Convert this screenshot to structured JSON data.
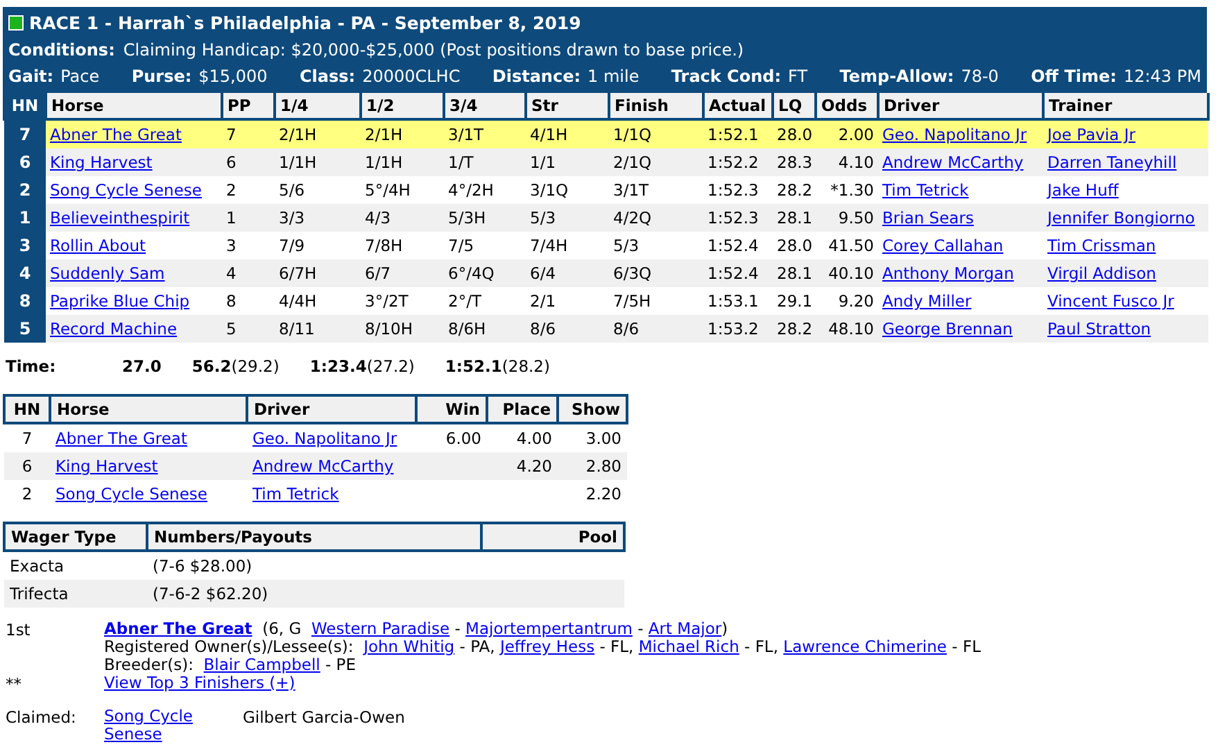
{
  "race": {
    "title": "RACE 1 - Harrah`s Philadelphia - PA - September 8, 2019",
    "conditions": {
      "label": "Conditions:",
      "value": "Claiming Handicap: $20,000-$25,000 (Post positions drawn to base price.)"
    },
    "info": [
      {
        "label": "Gait:",
        "value": "Pace"
      },
      {
        "label": "Purse:",
        "value": "$15,000"
      },
      {
        "label": "Class:",
        "value": "20000CLHC"
      },
      {
        "label": "Distance:",
        "value": "1 mile"
      },
      {
        "label": "Track Cond:",
        "value": "FT"
      },
      {
        "label": "Temp-Allow:",
        "value": "78-0"
      },
      {
        "label": "Off Time:",
        "value": "12:43 PM"
      }
    ]
  },
  "results": {
    "columns": [
      {
        "label": "HN",
        "kind": "hn"
      },
      {
        "label": "Horse",
        "kind": "link"
      },
      {
        "label": "PP",
        "kind": "text"
      },
      {
        "label": "1/4",
        "kind": "text"
      },
      {
        "label": "1/2",
        "kind": "text"
      },
      {
        "label": "3/4",
        "kind": "text"
      },
      {
        "label": "Str",
        "kind": "text"
      },
      {
        "label": "Finish",
        "kind": "text"
      },
      {
        "label": "Actual",
        "kind": "text"
      },
      {
        "label": "LQ",
        "kind": "text"
      },
      {
        "label": "Odds",
        "kind": "num"
      },
      {
        "label": "Driver",
        "kind": "link"
      },
      {
        "label": "Trainer",
        "kind": "link"
      }
    ],
    "rows": [
      {
        "highlighted": true,
        "cells": [
          "7",
          "Abner The Great",
          "7",
          "2/1H",
          "2/1H",
          "3/1T",
          "4/1H",
          "1/1Q",
          "1:52.1",
          "28.0",
          "2.00",
          "Geo. Napolitano Jr",
          "Joe Pavia Jr"
        ]
      },
      {
        "highlighted": false,
        "cells": [
          "6",
          "King Harvest",
          "6",
          "1/1H",
          "1/1H",
          "1/T",
          "1/1",
          "2/1Q",
          "1:52.2",
          "28.3",
          "4.10",
          "Andrew McCarthy",
          "Darren Taneyhill"
        ]
      },
      {
        "highlighted": false,
        "cells": [
          "2",
          "Song Cycle Senese",
          "2",
          "5/6",
          "5°/4H",
          "4°/2H",
          "3/1Q",
          "3/1T",
          "1:52.3",
          "28.2",
          "*1.30",
          "Tim Tetrick",
          "Jake Huff"
        ]
      },
      {
        "highlighted": false,
        "cells": [
          "1",
          "Believeinthespirit",
          "1",
          "3/3",
          "4/3",
          "5/3H",
          "5/3",
          "4/2Q",
          "1:52.3",
          "28.1",
          "9.50",
          "Brian Sears",
          "Jennifer Bongiorno"
        ]
      },
      {
        "highlighted": false,
        "cells": [
          "3",
          "Rollin About",
          "3",
          "7/9",
          "7/8H",
          "7/5",
          "7/4H",
          "5/3",
          "1:52.4",
          "28.0",
          "41.50",
          "Corey Callahan",
          "Tim Crissman"
        ]
      },
      {
        "highlighted": false,
        "cells": [
          "4",
          "Suddenly Sam",
          "4",
          "6/7H",
          "6/7",
          "6°/4Q",
          "6/4",
          "6/3Q",
          "1:52.4",
          "28.1",
          "40.10",
          "Anthony Morgan",
          "Virgil Addison"
        ]
      },
      {
        "highlighted": false,
        "cells": [
          "8",
          "Paprike Blue Chip",
          "8",
          "4/4H",
          "3°/2T",
          "2°/T",
          "2/1",
          "7/5H",
          "1:53.1",
          "29.1",
          "9.20",
          "Andy Miller",
          "Vincent Fusco Jr"
        ]
      },
      {
        "highlighted": false,
        "cells": [
          "5",
          "Record Machine",
          "5",
          "8/11",
          "8/10H",
          "8/6H",
          "8/6",
          "8/6",
          "1:53.2",
          "28.2",
          "48.10",
          "George Brennan",
          "Paul Stratton"
        ]
      }
    ]
  },
  "times": {
    "label": "Time:",
    "fractions": [
      {
        "time": "27.0"
      },
      {
        "time": "56.2",
        "split": "(29.2)"
      },
      {
        "time": "1:23.4",
        "split": "(27.2)"
      },
      {
        "time": "1:52.1",
        "split": "(28.2)"
      }
    ]
  },
  "payouts": {
    "columns": [
      "HN",
      "Horse",
      "Driver",
      "Win",
      "Place",
      "Show"
    ],
    "rows": [
      {
        "hn": "7",
        "horse": "Abner The Great",
        "driver": "Geo. Napolitano Jr",
        "win": "6.00",
        "place": "4.00",
        "show": "3.00"
      },
      {
        "hn": "6",
        "horse": "King Harvest",
        "driver": "Andrew McCarthy",
        "place": "4.20",
        "show": "2.80"
      },
      {
        "hn": "2",
        "horse": "Song Cycle Senese",
        "driver": "Tim Tetrick",
        "show": "2.20"
      }
    ]
  },
  "wagers": {
    "columns": [
      "Wager Type",
      "Numbers/Payouts",
      "Pool"
    ],
    "rows": [
      {
        "type": "Exacta",
        "payout": "(7-6 $28.00)"
      },
      {
        "type": "Trifecta",
        "payout": "(7-6-2 $62.20)"
      }
    ]
  },
  "details": [
    {
      "label": "1st",
      "lines": [
        [
          {
            "kind": "winner",
            "text": "Abner The Great"
          },
          {
            "kind": "text",
            "text": "  (6, G  "
          },
          {
            "kind": "link",
            "text": "Western Paradise"
          },
          {
            "kind": "text",
            "text": " - "
          },
          {
            "kind": "link",
            "text": "Majortempertantrum"
          },
          {
            "kind": "text",
            "text": " - "
          },
          {
            "kind": "link",
            "text": "Art Major"
          },
          {
            "kind": "text",
            "text": ")"
          }
        ],
        [
          {
            "kind": "text",
            "text": "Registered Owner(s)/Lessee(s):  "
          },
          {
            "kind": "link",
            "text": "John Whitig"
          },
          {
            "kind": "text",
            "text": " - PA, "
          },
          {
            "kind": "link",
            "text": "Jeffrey Hess"
          },
          {
            "kind": "text",
            "text": " - FL, "
          },
          {
            "kind": "link",
            "text": "Michael Rich"
          },
          {
            "kind": "text",
            "text": " - FL, "
          },
          {
            "kind": "link",
            "text": "Lawrence Chimerine"
          },
          {
            "kind": "text",
            "text": " - FL"
          }
        ],
        [
          {
            "kind": "text",
            "text": "Breeder(s):  "
          },
          {
            "kind": "link",
            "text": "Blair Campbell"
          },
          {
            "kind": "text",
            "text": " - PE"
          }
        ]
      ]
    },
    {
      "label": "**",
      "lines": [
        [
          {
            "kind": "link",
            "text": "View Top 3 Finishers (+)"
          }
        ]
      ]
    }
  ],
  "claimed": {
    "label": "Claimed:",
    "horse": "Song Cycle Senese",
    "claimant": "Gilbert Garcia-Owen"
  }
}
